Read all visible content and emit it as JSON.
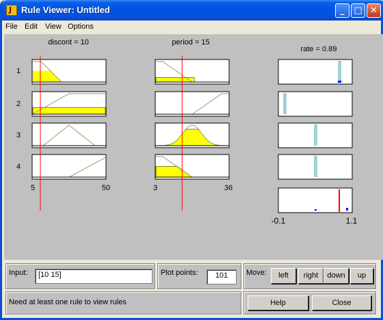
{
  "window": {
    "title": "Rule Viewer: Untitled",
    "app_icon_glyph": "J",
    "minimize_glyph": "_",
    "maximize_glyph": "□",
    "close_glyph": "✕"
  },
  "menu": [
    "File",
    "Edit",
    "View",
    "Options"
  ],
  "plots": {
    "inputs": [
      {
        "label": "discont = 10",
        "range_min": "5",
        "range_max": "50",
        "value": 10
      },
      {
        "label": "period = 15",
        "range_min": "3",
        "range_max": "36",
        "value": 15
      }
    ],
    "output": {
      "label": "rate = 0.89",
      "range_min": "-0.1",
      "range_max": "1.1",
      "value": 0.89
    },
    "rules": [
      "1",
      "2",
      "3",
      "4"
    ]
  },
  "controls": {
    "input_label": "Input:",
    "input_value": "[10 15]",
    "plot_points_label": "Plot points:",
    "plot_points_value": "101",
    "move_label": "Move:",
    "move_buttons": [
      "left",
      "right",
      "down",
      "up"
    ],
    "status": "Need at least one rule to view rules",
    "help_label": "Help",
    "close_label": "Close"
  },
  "colors": {
    "fill": "#ffff00",
    "curve": "#999966",
    "index_line": "#ff0000",
    "output_bar": "#a0d0d8",
    "output_mark": "#0000ff",
    "titlebar": "#0054e3"
  }
}
